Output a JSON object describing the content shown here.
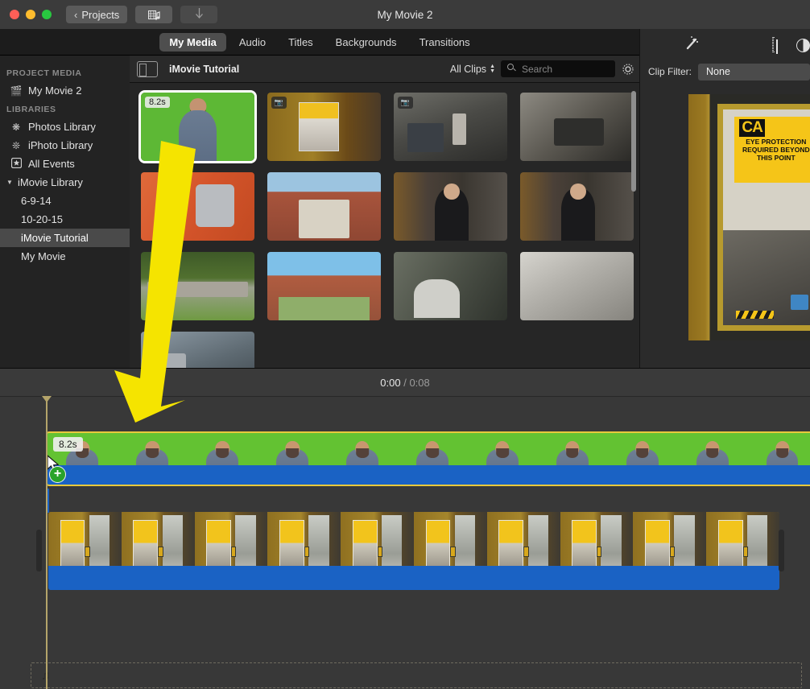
{
  "window": {
    "title": "My Movie 2",
    "traffic_lights": [
      "close",
      "minimize",
      "zoom"
    ],
    "back_button": "Projects",
    "import_media_icon": "film-music-icon",
    "download_icon": "download-arrow-icon"
  },
  "tabs": [
    {
      "label": "My Media",
      "active": true
    },
    {
      "label": "Audio",
      "active": false
    },
    {
      "label": "Titles",
      "active": false
    },
    {
      "label": "Backgrounds",
      "active": false
    },
    {
      "label": "Transitions",
      "active": false
    }
  ],
  "sidebar": {
    "project_media_header": "PROJECT MEDIA",
    "project_media_items": [
      {
        "label": "My Movie 2",
        "icon": "clapperboard-icon"
      }
    ],
    "libraries_header": "LIBRARIES",
    "library_items": [
      {
        "label": "Photos Library",
        "icon": "photos-icon"
      },
      {
        "label": "iPhoto Library",
        "icon": "iphoto-icon"
      },
      {
        "label": "All Events",
        "icon": "star-icon"
      }
    ],
    "imovie_library": {
      "label": "iMovie Library",
      "disclosure": "▼",
      "events": [
        {
          "label": "6-9-14",
          "selected": false
        },
        {
          "label": "10-20-15",
          "selected": false
        },
        {
          "label": "iMovie Tutorial",
          "selected": true
        },
        {
          "label": "My Movie",
          "selected": false
        }
      ]
    }
  },
  "browser": {
    "sidebar_toggle_icon": "sidebar-toggle-icon",
    "title": "iMovie Tutorial",
    "filter_label": "All Clips",
    "filter_chevron_icon": "up-down-chevron-icon",
    "search_placeholder": "Search",
    "search_value": "",
    "search_icon": "search-icon",
    "settings_icon": "gear-icon",
    "clips": [
      {
        "id": "c1",
        "kind": "video",
        "duration_badge": "8.2s",
        "selected": true,
        "thumb": "green-man",
        "alt": "man on green screen"
      },
      {
        "id": "c2",
        "kind": "photo",
        "duration_badge": "",
        "selected": false,
        "thumb": "caution-door",
        "alt": "caution sign on door"
      },
      {
        "id": "c3",
        "kind": "photo",
        "duration_badge": "",
        "selected": false,
        "thumb": "shop1",
        "alt": "machine shop workers"
      },
      {
        "id": "c4",
        "kind": "video",
        "duration_badge": "",
        "selected": false,
        "thumb": "shop2",
        "alt": "foundry castings"
      },
      {
        "id": "c5",
        "kind": "video",
        "duration_badge": "",
        "selected": false,
        "thumb": "mug",
        "alt": "metal mug on orange table"
      },
      {
        "id": "c6",
        "kind": "video",
        "duration_badge": "",
        "selected": false,
        "thumb": "bldg1",
        "alt": "brick campus building"
      },
      {
        "id": "c7",
        "kind": "video",
        "duration_badge": "",
        "selected": false,
        "thumb": "woman",
        "alt": "woman interview"
      },
      {
        "id": "c8",
        "kind": "video",
        "duration_badge": "",
        "selected": false,
        "thumb": "woman",
        "alt": "woman interview wide"
      },
      {
        "id": "c9",
        "kind": "video",
        "duration_badge": "",
        "selected": false,
        "thumb": "campus",
        "alt": "university sign on lawn"
      },
      {
        "id": "c10",
        "kind": "video",
        "duration_badge": "",
        "selected": false,
        "thumb": "bldg2",
        "alt": "campus building sunny"
      },
      {
        "id": "c11",
        "kind": "video",
        "duration_badge": "",
        "selected": false,
        "thumb": "lab1",
        "alt": "lab workers"
      },
      {
        "id": "c12",
        "kind": "video",
        "duration_badge": "",
        "selected": false,
        "thumb": "tarp",
        "alt": "covered equipment"
      },
      {
        "id": "c13",
        "kind": "video",
        "duration_badge": "",
        "selected": false,
        "thumb": "lab2",
        "alt": "students in workshop"
      }
    ]
  },
  "inspector": {
    "enhance_icon": "magic-wand-icon",
    "crop_icon": "crop-icon",
    "color_balance_icon": "color-balance-icon",
    "clip_filter_label": "Clip Filter:",
    "clip_filter_value": "None",
    "preview_alt": "CAUTION EYE PROTECTION REQUIRED BEYOND THIS POINT sign on door",
    "preview_sign_main": "CA",
    "preview_sign_lines": "EYE PROTECTION REQUIRED BEYOND THIS POINT"
  },
  "timeline": {
    "current_time": "0:00",
    "separator": "/",
    "total_time": "0:08",
    "clips": [
      {
        "id": "tl1",
        "duration_badge": "8.2s",
        "selected": true,
        "frames": 11,
        "thumb": "green-man",
        "has_audio_bar": true
      },
      {
        "id": "tl2",
        "duration_badge": "",
        "selected": false,
        "frames": 10,
        "thumb": "caution-door",
        "has_audio_bar": true
      }
    ],
    "drop_indicator": "+",
    "cursor_icon": "arrow-cursor-icon",
    "music_dropzone_icon": "music-note-icon"
  },
  "annotation": {
    "arrow_color": "#f5e400",
    "arrow_label": "drag clip to timeline"
  }
}
